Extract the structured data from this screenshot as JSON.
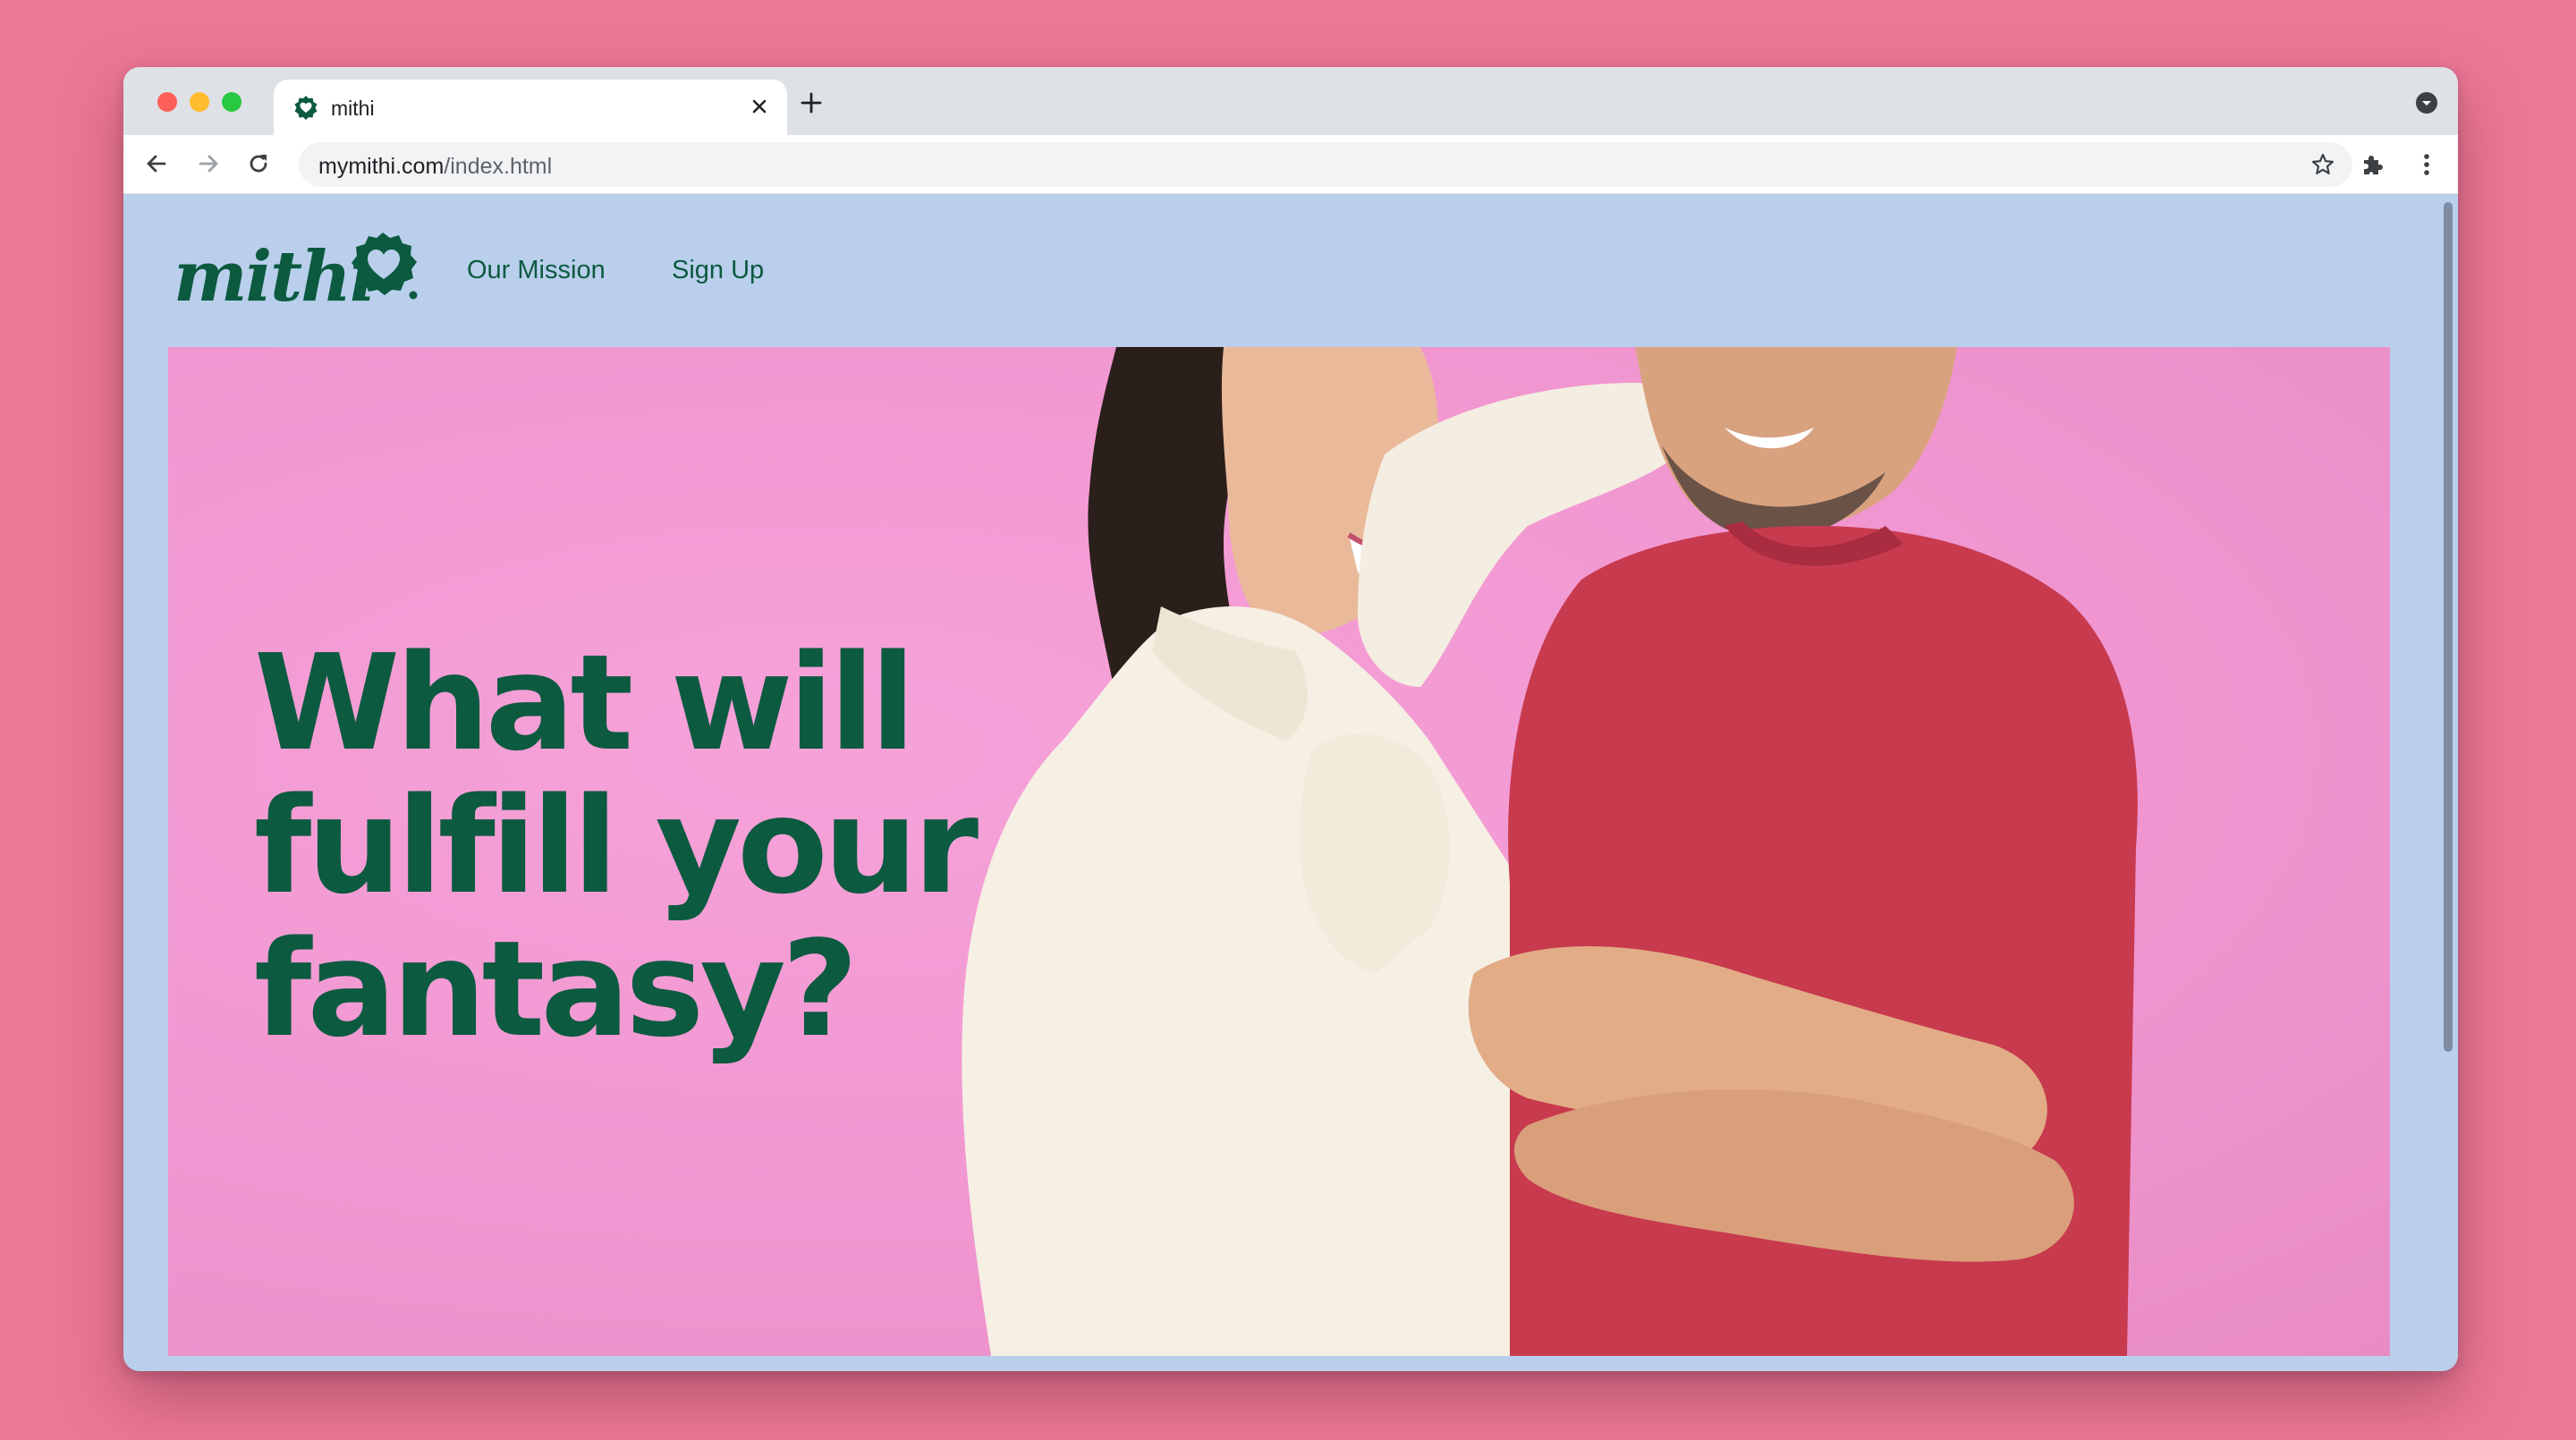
{
  "browser": {
    "tab_title": "mithi",
    "url_host": "mymithi.com",
    "url_path": "/index.html"
  },
  "site": {
    "logo_text": "mithi",
    "nav": [
      {
        "label": "Our Mission"
      },
      {
        "label": "Sign Up"
      }
    ],
    "hero": {
      "headline_lines": [
        "What will",
        "fulfill your",
        "fantasy?"
      ]
    }
  },
  "colors": {
    "page_background": "#ec7896",
    "site_background": "#b9cfec",
    "brand_green": "#0c5a40",
    "hero_pink": "#f095cf"
  },
  "icons": {
    "favicon": "heart-badge-icon",
    "logo_mark": "heart-badge-icon",
    "tab_close": "close-icon",
    "new_tab": "plus-icon",
    "tab_search": "chevron-down-circle-icon",
    "back": "arrow-left-icon",
    "forward": "arrow-right-icon",
    "reload": "reload-icon",
    "bookmark": "star-icon",
    "extensions": "puzzle-icon",
    "menu": "kebab-menu-icon"
  }
}
